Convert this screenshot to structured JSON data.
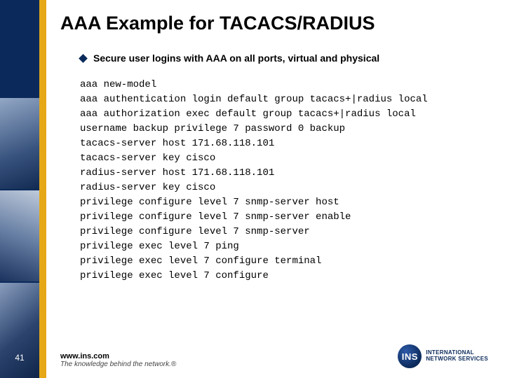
{
  "slide": {
    "number": "41",
    "title": "AAA Example for TACACS/RADIUS",
    "bullet": "Secure user logins with AAA on all ports, virtual and physical",
    "code_lines": [
      "aaa new-model",
      "aaa authentication login default group tacacs+|radius local",
      "aaa authorization exec default group tacacs+|radius local",
      "username backup privilege 7 password 0 backup",
      "tacacs-server host 171.68.118.101",
      "tacacs-server key cisco",
      "radius-server host 171.68.118.101",
      "radius-server key cisco",
      "privilege configure level 7 snmp-server host",
      "privilege configure level 7 snmp-server enable",
      "privilege configure level 7 snmp-server",
      "privilege exec level 7 ping",
      "privilege exec level 7 configure terminal",
      "privilege exec level 7 configure"
    ]
  },
  "footer": {
    "url": "www.ins.com",
    "tagline": "The knowledge behind the network.®"
  },
  "logo": {
    "initials": "INS",
    "label_line1": "INTERNATIONAL",
    "label_line2": "NETWORK SERVICES"
  }
}
